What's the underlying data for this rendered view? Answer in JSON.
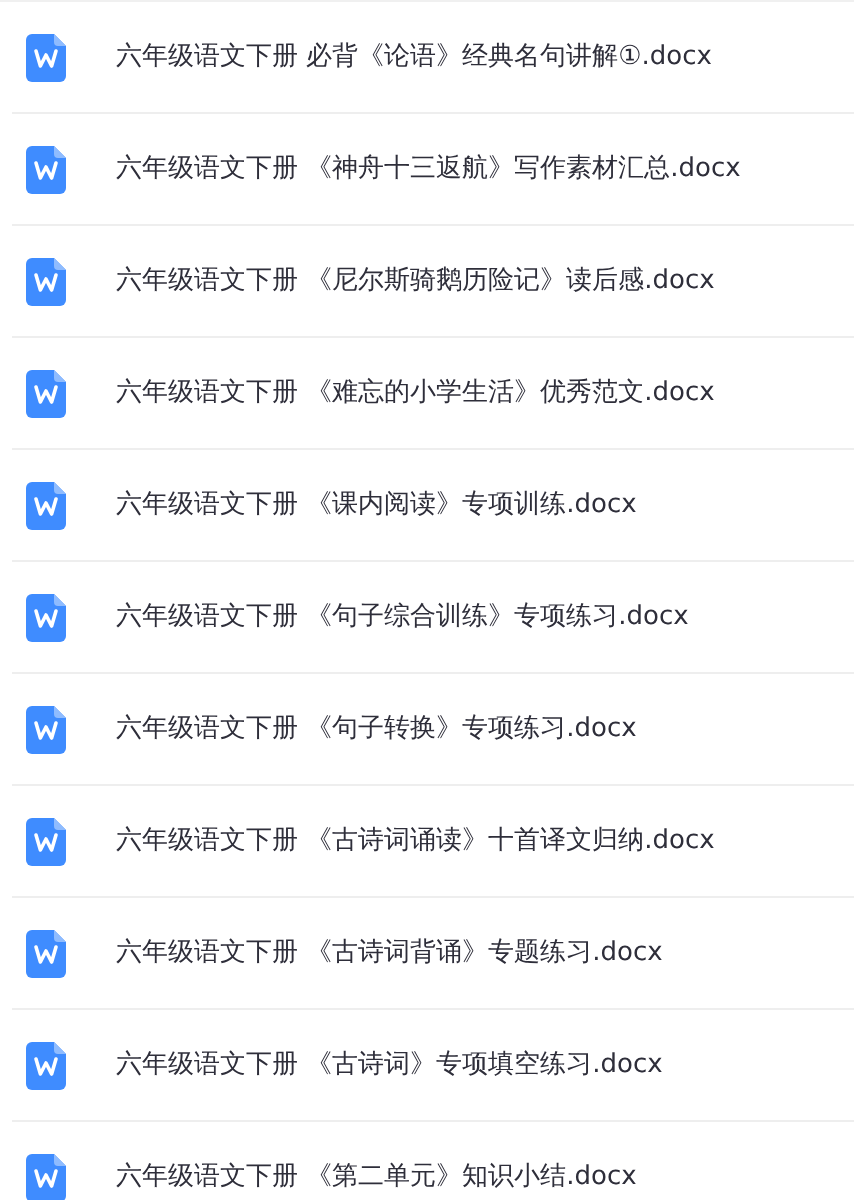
{
  "files": [
    {
      "name": "六年级语文下册 必背《论语》经典名句讲解①.docx"
    },
    {
      "name": "六年级语文下册 《神舟十三返航》写作素材汇总.docx"
    },
    {
      "name": "六年级语文下册 《尼尔斯骑鹅历险记》读后感.docx"
    },
    {
      "name": "六年级语文下册 《难忘的小学生活》优秀范文.docx"
    },
    {
      "name": "六年级语文下册 《课内阅读》专项训练.docx"
    },
    {
      "name": "六年级语文下册 《句子综合训练》专项练习.docx"
    },
    {
      "name": "六年级语文下册 《句子转换》专项练习.docx"
    },
    {
      "name": "六年级语文下册 《古诗词诵读》十首译文归纳.docx"
    },
    {
      "name": "六年级语文下册 《古诗词背诵》专题练习.docx"
    },
    {
      "name": "六年级语文下册 《古诗词》专项填空练习.docx"
    },
    {
      "name": "六年级语文下册 《第二单元》知识小结.docx"
    }
  ]
}
